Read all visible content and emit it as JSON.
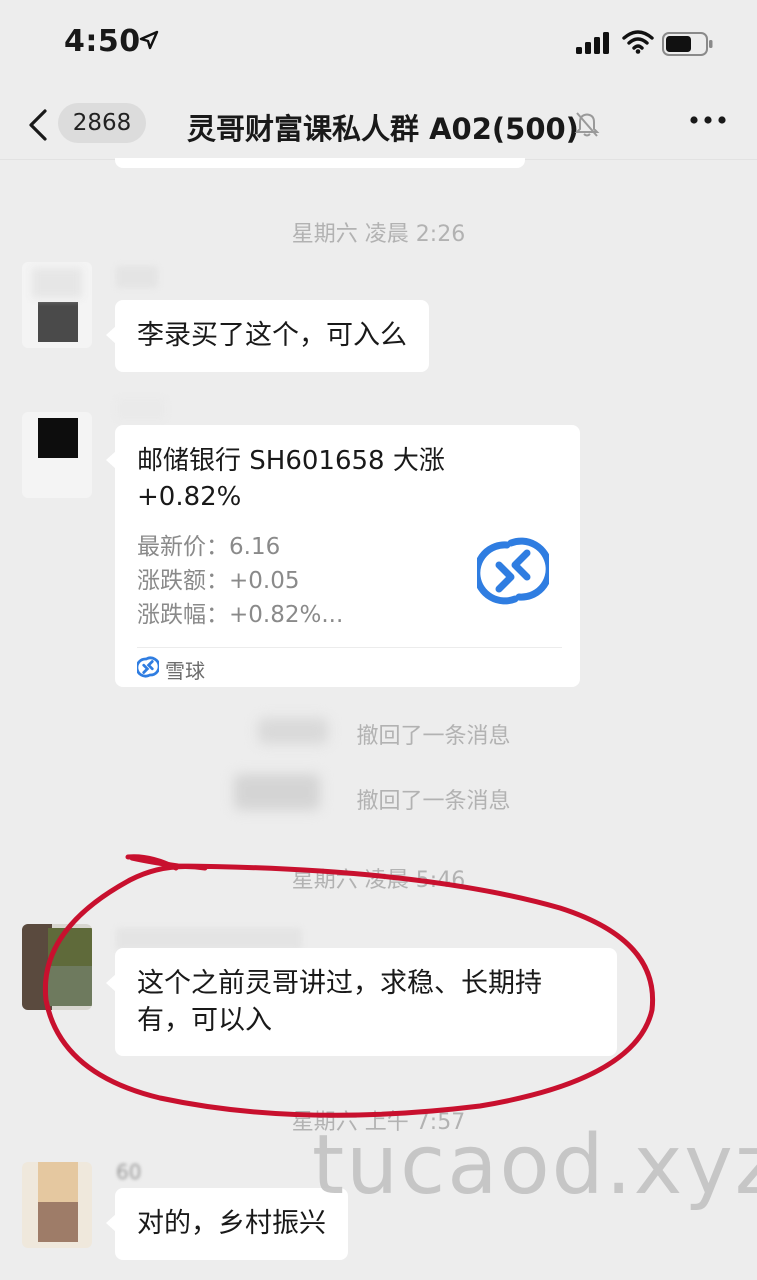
{
  "status_bar": {
    "time": "4:50"
  },
  "nav": {
    "unread_count": "2868",
    "title": "灵哥财富课私人群 A02(500)"
  },
  "messages": {
    "time_1": "星期六 凌晨 2:26",
    "msg_1": "李录买了这个，可入么",
    "card": {
      "title": "邮储银行 SH601658 大涨 +0.82%",
      "latest_price_label": "最新价：",
      "latest_price": "6.16",
      "change_amount_label": "涨跌额：",
      "change_amount": "+0.05",
      "change_pct_label": "涨跌幅：",
      "change_pct": "+0.82%...",
      "source": "雪球"
    },
    "recall_1": "撤回了一条消息",
    "recall_2": "撤回了一条消息",
    "time_2": "星期六 凌晨 5:46",
    "msg_2": "这个之前灵哥讲过，求稳、长期持有，可以入",
    "time_3": "星期六 上午 7:57",
    "sender_4": "60",
    "msg_3": "对的，乡村振兴"
  },
  "watermark": "tucaod.xyz",
  "colors": {
    "background": "#ededed",
    "bubble": "#ffffff",
    "annotation": "#c8102e",
    "xueqiu_blue": "#2f7de1"
  }
}
